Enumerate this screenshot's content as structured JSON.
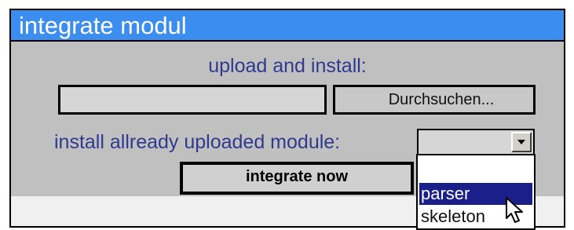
{
  "panel": {
    "title": "integrate modul",
    "upload_label": "upload and install:",
    "file_input_value": "",
    "browse_label": "Durchsuchen...",
    "install_label": "install allready uploaded module:",
    "select_value": "",
    "integrate_label": "integrate now"
  },
  "dropdown": {
    "options": [
      "",
      "parser",
      "skeleton"
    ],
    "highlighted": "parser"
  },
  "colors": {
    "title_bg": "#3c8df0",
    "label_text": "#2f3a8f",
    "highlight_bg": "#1a1f8a"
  },
  "icons": [
    "chevron-down-icon",
    "mouse-pointer-icon"
  ]
}
